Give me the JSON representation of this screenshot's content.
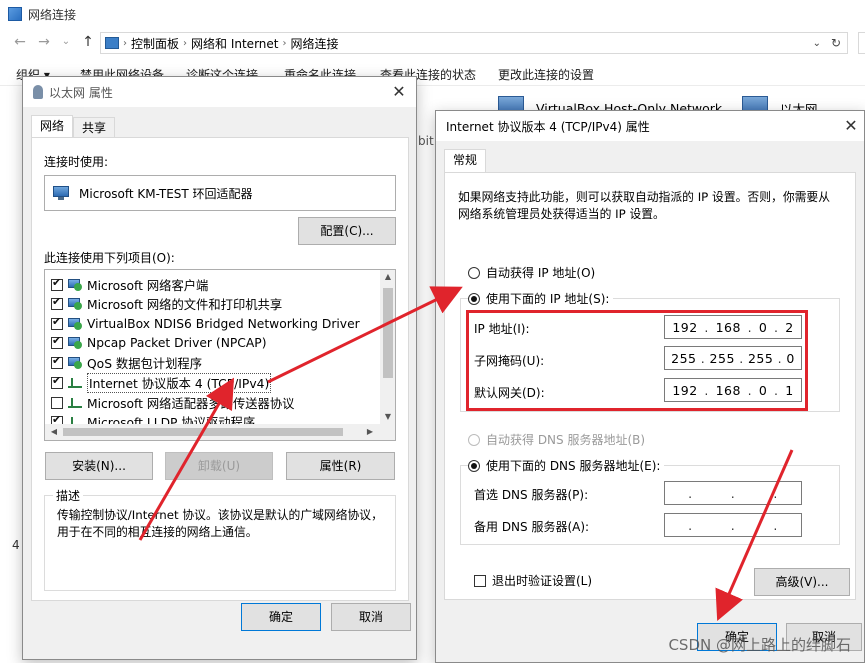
{
  "explorer": {
    "window_title": "网络连接",
    "breadcrumb": [
      "控制面板",
      "网络和 Internet",
      "网络连接"
    ],
    "commands": [
      "组织 ▾",
      "禁用此网络设备",
      "诊断这个连接",
      "重命名此连接",
      "查看此连接的状态",
      "更改此连接的设置"
    ],
    "items": [
      {
        "name": "VirtualBox Host-Only Network"
      },
      {
        "name": "以太网"
      }
    ],
    "side_text_bit": "bit",
    "side_text_4": "4"
  },
  "ethernet_dialog": {
    "title": "以太网 属性",
    "tabs": [
      "网络",
      "共享"
    ],
    "connect_using_label": "连接时使用:",
    "adapter_name": "Microsoft KM-TEST 环回适配器",
    "configure_button": "配置(C)...",
    "items_label": "此连接使用下列项目(O):",
    "components": [
      {
        "label": "Microsoft 网络客户端",
        "checked": true,
        "icon": "network-client-icon"
      },
      {
        "label": "Microsoft 网络的文件和打印机共享",
        "checked": true,
        "icon": "file-share-icon"
      },
      {
        "label": "VirtualBox NDIS6 Bridged Networking Driver",
        "checked": true,
        "icon": "driver-icon"
      },
      {
        "label": "Npcap Packet Driver (NPCAP)",
        "checked": true,
        "icon": "driver-icon"
      },
      {
        "label": "QoS 数据包计划程序",
        "checked": true,
        "icon": "qos-icon"
      },
      {
        "label": "Internet 协议版本 4 (TCP/IPv4)",
        "checked": true,
        "icon": "protocol-icon"
      },
      {
        "label": "Microsoft 网络适配器多路传送器协议",
        "checked": false,
        "icon": "protocol-icon"
      },
      {
        "label": "Microsoft LLDP 协议驱动程序",
        "checked": true,
        "icon": "protocol-icon"
      }
    ],
    "install_button": "安装(N)...",
    "uninstall_button": "卸载(U)",
    "properties_button": "属性(R)",
    "description_label": "描述",
    "description_text": "传输控制协议/Internet 协议。该协议是默认的广域网络协议，用于在不同的相互连接的网络上通信。",
    "ok_button": "确定",
    "cancel_button": "取消"
  },
  "ipv4_dialog": {
    "title": "Internet 协议版本 4 (TCP/IPv4) 属性",
    "tab": "常规",
    "intro": "如果网络支持此功能，则可以获取自动指派的 IP 设置。否则，你需要从网络系统管理员处获得适当的 IP 设置。",
    "auto_ip_label": "自动获得 IP 地址(O)",
    "manual_ip_label": "使用下面的 IP 地址(S):",
    "ip_label": "IP 地址(I):",
    "ip_value": [
      "192",
      "168",
      "0",
      "2"
    ],
    "mask_label": "子网掩码(U):",
    "mask_value": [
      "255",
      "255",
      "255",
      "0"
    ],
    "gateway_label": "默认网关(D):",
    "gateway_value": [
      "192",
      "168",
      "0",
      "1"
    ],
    "auto_dns_label": "自动获得 DNS 服务器地址(B)",
    "manual_dns_label": "使用下面的 DNS 服务器地址(E):",
    "preferred_dns_label": "首选 DNS 服务器(P):",
    "alternate_dns_label": "备用 DNS 服务器(A):",
    "validate_label": "退出时验证设置(L)",
    "advanced_button": "高级(V)...",
    "ok_button": "确定",
    "cancel_button": "取消"
  },
  "watermark": "CSDN @网上路上的绊脚石",
  "colors": {
    "highlight": "#e0242c",
    "accent": "#0078d7"
  }
}
